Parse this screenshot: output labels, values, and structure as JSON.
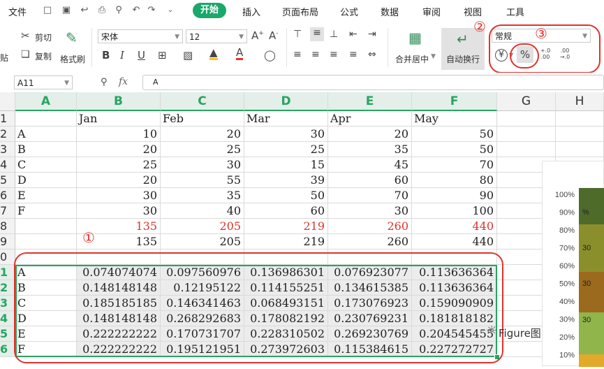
{
  "menubar": {
    "file": "文件",
    "tabs": [
      "开始",
      "插入",
      "页面布局",
      "公式",
      "数据",
      "审阅",
      "视图",
      "工具"
    ]
  },
  "ribbon": {
    "paste": "贴",
    "cut": "剪切",
    "copy": "复制",
    "format_painter": "格式刷",
    "font_name": "宋体",
    "font_size": "12",
    "merge_center": "合并居中",
    "wrap_text": "自动换行",
    "number_format": "常规",
    "percent_glyph": "%",
    "currency_glyph": "¥",
    "dec_increase": "+.0 .00",
    "dec_decrease": ".00 →.0"
  },
  "annotations": {
    "one": "①",
    "two": "②",
    "three": "③"
  },
  "formula_bar": {
    "name_box": "A11",
    "fx": "fx",
    "value": "A"
  },
  "columns": [
    "A",
    "B",
    "C",
    "D",
    "E",
    "F",
    "G",
    "H"
  ],
  "row_numbers": [
    "1",
    "2",
    "3",
    "4",
    "5",
    "6",
    "7",
    "8",
    "9",
    "0",
    "1",
    "2",
    "3",
    "4",
    "5",
    "6"
  ],
  "rows": [
    {
      "a": "",
      "v": [
        "Jan",
        "Feb",
        "Mar",
        "Apr",
        "May"
      ],
      "style": "header"
    },
    {
      "a": "A",
      "v": [
        "10",
        "20",
        "30",
        "20",
        "50"
      ]
    },
    {
      "a": "B",
      "v": [
        "20",
        "25",
        "25",
        "35",
        "50"
      ]
    },
    {
      "a": "C",
      "v": [
        "25",
        "30",
        "15",
        "45",
        "70"
      ]
    },
    {
      "a": "D",
      "v": [
        "20",
        "55",
        "39",
        "60",
        "80"
      ]
    },
    {
      "a": "E",
      "v": [
        "30",
        "35",
        "50",
        "70",
        "90"
      ]
    },
    {
      "a": "F",
      "v": [
        "30",
        "40",
        "60",
        "30",
        "100"
      ]
    },
    {
      "a": "",
      "v": [
        "135",
        "205",
        "219",
        "260",
        "440"
      ],
      "style": "red"
    },
    {
      "a": "",
      "v": [
        "135",
        "205",
        "219",
        "260",
        "440"
      ]
    },
    {
      "a": "",
      "v": [
        "",
        "",
        "",
        "",
        ""
      ]
    },
    {
      "a": "A",
      "v": [
        "0.074074074",
        "0.097560976",
        "0.136986301",
        "0.076923077",
        "0.113636364"
      ],
      "style": "pct"
    },
    {
      "a": "B",
      "v": [
        "0.148148148",
        "0.12195122",
        "0.114155251",
        "0.134615385",
        "0.113636364"
      ],
      "style": "pct"
    },
    {
      "a": "C",
      "v": [
        "0.185185185",
        "0.146341463",
        "0.068493151",
        "0.173076923",
        "0.159090909"
      ],
      "style": "pct"
    },
    {
      "a": "D",
      "v": [
        "0.148148148",
        "0.268292683",
        "0.178082192",
        "0.230769231",
        "0.181818182"
      ],
      "style": "pct"
    },
    {
      "a": "E",
      "v": [
        "0.222222222",
        "0.170731707",
        "0.228310502",
        "0.269230769",
        "0.204545455"
      ],
      "style": "pct"
    },
    {
      "a": "F",
      "v": [
        "0.222222222",
        "0.195121951",
        "0.273972603",
        "0.115384615",
        "0.227272727"
      ],
      "style": "pct"
    }
  ],
  "chart": {
    "y_ticks": [
      "100%",
      "90%",
      "80%",
      "70%",
      "60%",
      "50%",
      "40%",
      "30%",
      "20%",
      "10%"
    ],
    "data_labels": [
      "%",
      "30",
      "30",
      "30"
    ],
    "colors": [
      "#4e6b2a",
      "#8a8f2b",
      "#9c6a1e",
      "#8fb54b",
      "#e2a92a"
    ]
  },
  "watermark": "Figure图"
}
